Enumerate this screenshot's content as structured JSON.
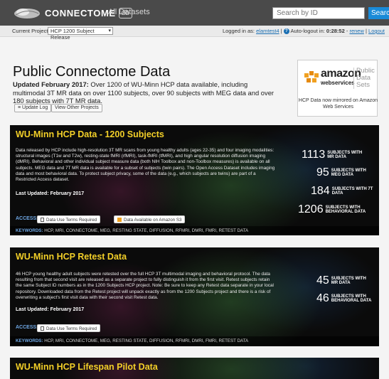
{
  "nav": {
    "brand": "CONNECTOME",
    "brand_badge": "db",
    "all_datasets": "All Datasets",
    "search_placeholder": "Search by ID",
    "search_button": "Search"
  },
  "subbar": {
    "current_project_label": "Current Project:",
    "current_project_value": "HCP 1200 Subject Release",
    "logged_in_as": "Logged in as:",
    "username": "elamtest4",
    "separator": "|",
    "auto_logout_label": "Auto-logout in:",
    "timer": "0:28:52",
    "renew_sep": "-",
    "renew": "renew",
    "logout": "Logout"
  },
  "header": {
    "title": "Public Connectome Data",
    "subtitle_bold": "Updated February 2017:",
    "subtitle_rest": " Over 1200 of WU-Minn HCP data available, including multimodal 3T MR data on over 1100 subjects, over 90 subjects with MEG data and over 180 subjects with 7T MR data.",
    "update_log": "Update Log",
    "view_other": "View Other Projects"
  },
  "amazon": {
    "word": "amazon",
    "webservices": "webservices",
    "public": "Public",
    "data_sets": "Data Sets",
    "mirror_text": "HCP Data now mirrored on Amazon Web Services"
  },
  "cards": [
    {
      "title": "WU-Minn HCP Data - 1200 Subjects",
      "description": "Data released by HCP include high-resolution 3T MR scans from young healthy adults (ages 22-35) and four imaging modalities: structural images (T1w and T2w), resting-state fMRI (rfMRI), task-fMRI (tfMRI), and high angular resolution diffusion imaging (dMRI). Behavioral and other individual subject measure data (both NIH Toolbox and non-Toolbox measures) is available on all subjects. MEG data and 7T MR data is available for a subset of subjects (twin pairs). The Open Access Dataset includes imaging data and most behavioral data. To protect subject privacy, some of the data (e.g., which subjects are twins) are part of a Restricted Access dataset.",
      "updated": "Last Updated: February 2017",
      "access_label": "ACCESS:",
      "access_buttons": [
        "Data Use Terms Required",
        "Data Available on Amazon S3"
      ],
      "stats": [
        {
          "num": "1113",
          "l1": "SUBJECTS WITH",
          "l2": "MR DATA"
        },
        {
          "num": "95",
          "l1": "SUBJECTS WITH",
          "l2": "MEG DATA"
        },
        {
          "num": "184",
          "l1": "SUBJECTS WITH 7T",
          "l2": "DATA"
        },
        {
          "num": "1206",
          "l1": "SUBJECTS WITH",
          "l2": "BEHAVIORAL DATA"
        }
      ],
      "keywords_label": "KEYWORDS:",
      "keywords": "HCP, MRI, CONNECTOME, MEG, RESTING STATE, DIFFUSION, RFMRI, DMRI, FMRI, RETEST DATA"
    },
    {
      "title": "WU-Minn HCP Retest Data",
      "description": "46 HCP young healthy adult subjects were retested over the full HCP 3T multimodal imaging and behavioral protocol. The data resulting from that second visit are released as a separate project to fully distinguish it from the first visit. Retest subjects retain the same Subject ID numbers as in the 1200 Subjects HCP project. Note: Be sure to keep any Retest data separate in your local repository. Downloaded data from the Retest project will unpack exactly as from the 1200 Subjects project and there is a risk of overwriting a subject's first visit data with their second visit Retest data.",
      "updated": "Last Updated: February 2017",
      "access_label": "ACCESS:",
      "access_buttons": [
        "Data Use Terms Required"
      ],
      "stats": [
        {
          "num": "45",
          "l1": "SUBJECTS WITH",
          "l2": "MR DATA"
        },
        {
          "num": "46",
          "l1": "SUBJECTS WITH",
          "l2": "BEHAVIORAL DATA"
        }
      ],
      "keywords_label": "KEYWORDS:",
      "keywords": "HCP, MRI, CONNECTOME, MEG, RESTING STATE, DIFFUSION, RFMRI, DMRI, FMRI, RETEST DATA"
    },
    {
      "title": "WU-Minn HCP Lifespan Pilot Data"
    }
  ],
  "colors": {
    "nav_bg": "#4a4a4a",
    "card_title": "#f2cf28",
    "access_blue": "#6fa8e6",
    "search_blue": "#1a8bd8"
  }
}
